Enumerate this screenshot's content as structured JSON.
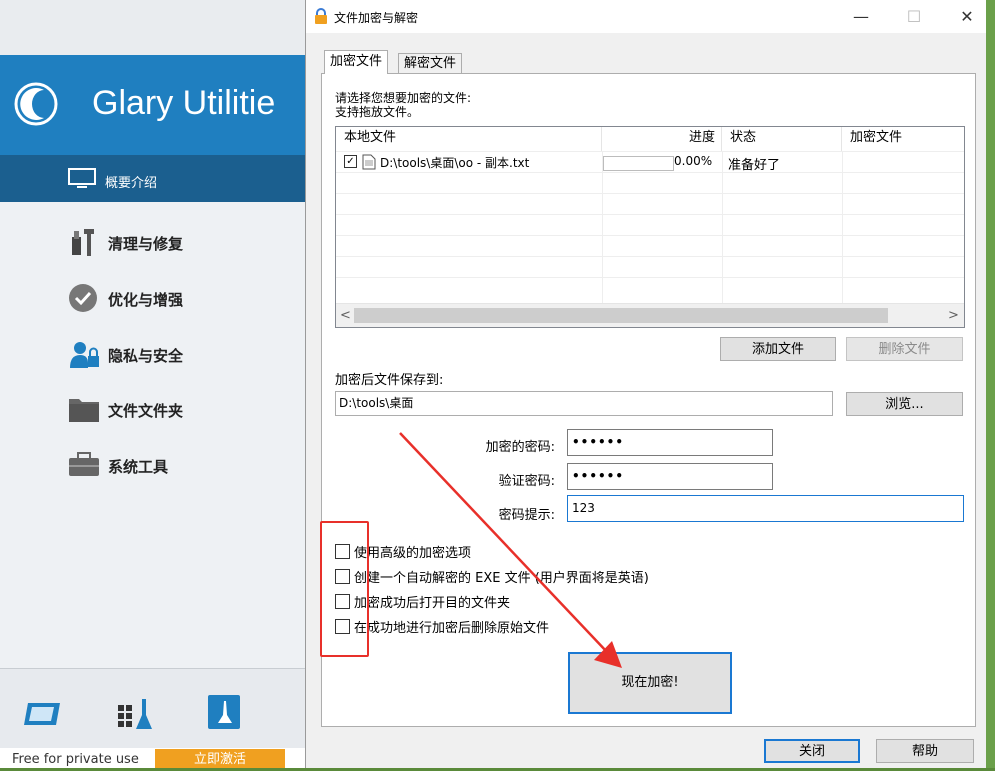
{
  "background_app": {
    "title": "Glary Utilitie",
    "overview_label": "概要介绍",
    "menu": [
      {
        "label": "清理与修复",
        "icon": "tools-icon"
      },
      {
        "label": "优化与增强",
        "icon": "checkmark-circle-icon"
      },
      {
        "label": "隐私与安全",
        "icon": "user-lock-icon"
      },
      {
        "label": "文件文件夹",
        "icon": "folder-icon"
      },
      {
        "label": "系统工具",
        "icon": "toolbox-icon"
      }
    ],
    "free_text": "Free for private use",
    "activate_label": "立即激活",
    "colors": {
      "header": "#1f7fc0",
      "overview": "#1b5f8f",
      "activate": "#f0a020"
    }
  },
  "dialog": {
    "title": "文件加密与解密",
    "tabs": [
      "加密文件",
      "解密文件"
    ],
    "instruction_line1": "请选择您想要加密的文件:",
    "instruction_line2": "支持拖放文件。",
    "table": {
      "columns": [
        "本地文件",
        "进度",
        "状态",
        "加密文件"
      ],
      "rows": [
        {
          "checked": true,
          "file": "D:\\tools\\桌面\\oo - 副本.txt",
          "progress": 0.0,
          "progress_text": "0.00%",
          "status": "准备好了",
          "encrypted_file": ""
        }
      ]
    },
    "add_file_label": "添加文件",
    "remove_file_label": "删除文件",
    "save_to_label": "加密后文件保存到:",
    "save_path": "D:\\tools\\桌面",
    "browse_label": "浏览...",
    "password_label": "加密的密码:",
    "password_value": "••••••",
    "verify_label": "验证密码:",
    "verify_value": "••••••",
    "hint_label": "密码提示:",
    "hint_value": "123",
    "options": [
      {
        "label": "使用高级的加密选项",
        "checked": false
      },
      {
        "label": "创建一个自动解密的 EXE 文件 (用户界面将是英语)",
        "checked": false
      },
      {
        "label": "加密成功后打开目的文件夹",
        "checked": false
      },
      {
        "label": "在成功地进行加密后删除原始文件",
        "checked": false
      }
    ],
    "encrypt_now_label": "现在加密!",
    "close_label": "关闭",
    "help_label": "帮助",
    "titlebar_buttons": {
      "min": "—",
      "max": "☐",
      "close": "✕"
    },
    "annotation_color": "#e8302a",
    "accent_color": "#1a78d2"
  }
}
